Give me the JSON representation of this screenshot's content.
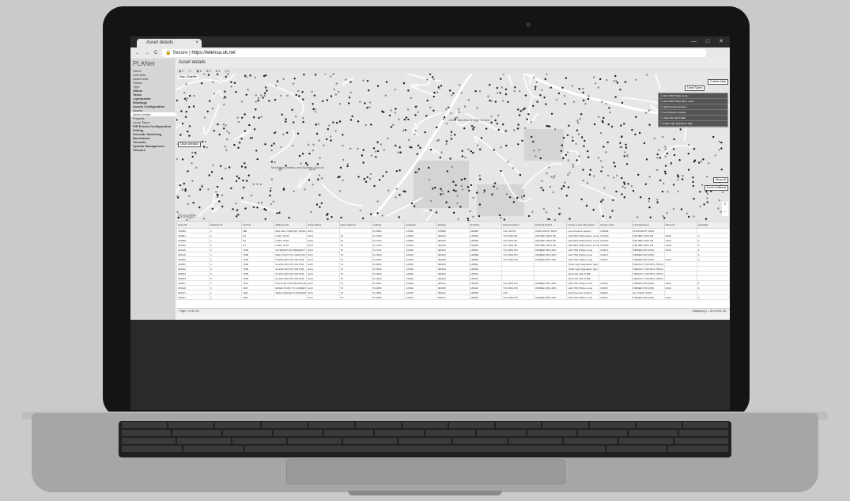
{
  "browser": {
    "tab_title": "Asset details",
    "tab_close": "×",
    "nav_back": "←",
    "nav_forward": "→",
    "nav_reload": "C",
    "url_secure": "Secure",
    "url_host": "https://telensa.uk.net"
  },
  "app": {
    "logo": "PLANet",
    "page_title": "Asset details",
    "sidebar": [
      {
        "label": "Home",
        "style": "plain"
      },
      {
        "label": "Licenses",
        "style": "plain"
      },
      {
        "label": "Asset Lists",
        "style": "plain"
      },
      {
        "label": "Places",
        "style": "plain"
      },
      {
        "label": "Type",
        "style": "plain"
      },
      {
        "label": "Status",
        "style": "bold"
      },
      {
        "label": "Tasks",
        "style": "bold"
      },
      {
        "label": "Lightmaster",
        "style": "bold"
      },
      {
        "label": "Readings",
        "style": "bold"
      },
      {
        "label": "Assets Configuration",
        "style": "bold"
      },
      {
        "label": "Assets",
        "style": "plain"
      },
      {
        "label": "Asset details",
        "style": "sel"
      },
      {
        "label": "Projects",
        "style": "plain"
      },
      {
        "label": "Lamp Types",
        "style": "plain"
      },
      {
        "label": "PIR Events Configuration",
        "style": "bold"
      },
      {
        "label": "Polling",
        "style": "bold"
      },
      {
        "label": "Override Switching",
        "style": "bold"
      },
      {
        "label": "Boundaries",
        "style": "bold"
      },
      {
        "label": "Telecells",
        "style": "bold"
      },
      {
        "label": "System Management",
        "style": "bold"
      },
      {
        "label": "Telecare",
        "style": "bold"
      }
    ],
    "map": {
      "tabs": [
        "Map",
        "Satellite"
      ],
      "clear_selection": "Clear selection",
      "custom_map": "Custom Map",
      "lamp_types": "Lamp Types",
      "show_all": "Show all",
      "zoom_to_filtered": "Zoom to filtered",
      "google": "Google",
      "zoom_in": "+",
      "zoom_out": "−",
      "place_1": "Anne Sandhurst High School",
      "place_2": "Monkland Infants and Nursery School"
    },
    "grid": {
      "columns": [
        "Asset ID",
        "Network ID",
        "Unit No",
        "Address Info",
        "Asset Status",
        "Asset Status 2",
        "Latitude",
        "Longitude",
        "Easting",
        "Northing",
        "Network Field 1",
        "Network Field 2",
        "Unique Lamp Information",
        "Design Lock",
        "Commissioned",
        "Street ID",
        "Capability"
      ],
      "rows": [
        [
          "766082",
          "1",
          "880",
          "MILL RD 1 HARTLEY ROAD",
          "ECO",
          "",
          "51.3683",
          "-0.8393",
          "478060",
          "169080",
          "TCU 4W PR",
          "PHPR MAXIT 100%",
          "Low Pressure Sodium",
          "010082",
          "PHPR MAXIT 100%",
          "",
          ""
        ],
        [
          "233921",
          "1",
          "P1",
          "LANG, P1ST",
          "ECO",
          "70",
          "51.3700",
          "-0.8310",
          "482121",
          "169530",
          "TCU 84W DP",
          "DIM 0BD 100% PR",
          "LED 84W Philips Micro Luma",
          "010340",
          "DIM 0BD 100% PR",
          "4/021",
          "9",
          "ON"
        ],
        [
          "233956",
          "1",
          "P4",
          "LANG, P1ST",
          "ECO",
          "70",
          "51.3714",
          "-0.8306",
          "482120",
          "169536",
          "TCU 84W DP",
          "DIM 0BD 100% PR",
          "LED 84W Philips Micro Luma",
          "010340",
          "DIM 0BD 100% PR",
          "4/021",
          "9",
          "ON"
        ],
        [
          "234023",
          "1",
          "P7",
          "LANG, P1ST",
          "ECO",
          "70",
          "51.3723",
          "-0.8304",
          "482118",
          "169540",
          "TCU 84W DP",
          "DIM 0BD 100% PR",
          "LED 84W Philips Micro Luma",
          "010340",
          "DIM 0BD 100% PR",
          "4/021",
          "9",
          "ON"
        ],
        [
          "234115",
          "1",
          "T503",
          "ALTERNATION CRESCENT",
          "ECO",
          "70",
          "51.3701",
          "-0.8322",
          "482104",
          "169552",
          "TCU 84W DIV",
          "DIMMED 050 100%",
          "LED 70W Philips Luma",
          "010017",
          "DIMMED 050 100%",
          "4/021",
          "9",
          "ON"
        ],
        [
          "235116",
          "1",
          "T508",
          "WELL FOOT TO LANGTON CL",
          "ECO",
          "70",
          "51.3693",
          "-0.8313",
          "482102",
          "169568",
          "TCU 84W DIV",
          "DIMMED 050 100%",
          "LED 70W Philips Luma",
          "010017",
          "DIMMED 050 100%",
          "",
          "9",
          "ON"
        ],
        [
          "235180",
          "1",
          "T509",
          "W HIGH RD NTS 200 PUB",
          "ECO",
          "70",
          "51.3663",
          "-0.8329",
          "482100",
          "169580",
          "TCU 84W DIV",
          "DIMMED 050 100%",
          "LED 70W Philips Luma",
          "010017",
          "DIMMED 050 100%",
          "4/021",
          "9",
          "ON"
        ],
        [
          "235181",
          "2",
          "T508",
          "W HIGH RD NTS 201 PUB",
          "ECO",
          "70",
          "51.3663",
          "-0.8329",
          "482100",
          "169590",
          "",
          "",
          "Traffic Light Regulation Sign",
          "",
          "DEFAULT CONTROL PROG.",
          "",
          "",
          ""
        ],
        [
          "235182",
          "3",
          "T508",
          "W HIGH RD NTS 202 PUB",
          "ECO",
          "70",
          "51.3663",
          "-0.8329",
          "482100",
          "169600",
          "",
          "",
          "Traffic Light Regulation Sign",
          "",
          "DEFAULT CONTROL PROG.",
          "",
          "",
          ""
        ],
        [
          "235183",
          "4",
          "T508",
          "W HIGH RD NTS 203 PUB",
          "ECO",
          "70",
          "51.3663",
          "-0.8329",
          "482100",
          "169610",
          "",
          "",
          "HIGH 4W LED TUBE",
          "",
          "DEFAULT CONTROL PROG.",
          "",
          "",
          ""
        ],
        [
          "235184",
          "5",
          "T508",
          "W HIGH RD NTS 204 PUB",
          "ECO",
          "70",
          "51.3663",
          "-0.8329",
          "482100",
          "169620",
          "",
          "",
          "HIGH 4W LED TUBE",
          "",
          "DEFAULT CONTROL PROG.",
          "",
          "",
          ""
        ],
        [
          "235221",
          "1",
          "T507",
          "OLD PUB, STN END ROUND",
          "ECO",
          "70",
          "51.3661",
          "-0.8326",
          "482101",
          "169630",
          "TCU 84W DIV",
          "DIMMED 050 100%",
          "LED 70W Philips Luma",
          "010017",
          "DIMMED 050 100%",
          "4/021",
          "9",
          "ON"
        ],
        [
          "235148",
          "1",
          "L507",
          "ESSEX ROAD TO CAMDEN HILL",
          "ECO",
          "70",
          "51.3653",
          "-0.8319",
          "482108",
          "169640",
          "TCU 84W DIV",
          "DIMMED 050 100%",
          "LED 70W Philips Luma",
          "010017",
          "DIMMED 050 100%",
          "4/021",
          "9",
          "ON"
        ],
        [
          "235217",
          "1",
          "L502",
          "SIDE GARAGE TO MORGAN LS",
          "ECO",
          "70",
          "51.3651",
          "-0.8315",
          "482112",
          "169650",
          "LPS",
          "",
          "High Pressure Sodium",
          "010017",
          "ALL NIGHT 100%",
          "",
          "",
          ""
        ],
        [
          "235221",
          "1",
          "L504",
          "",
          "ECO",
          "70",
          "51.3659",
          "-0.8322",
          "482114",
          "169660",
          "TCU 84W DIV",
          "DIMMED 050 100%",
          "LED 70W Philips Luma",
          "010017",
          "DIMMED 050 100%",
          "4/021",
          "9",
          "ON"
        ]
      ]
    },
    "pager": {
      "text": "Page 1 of 8,244",
      "right": "Displaying 1 - 25 of 206,101"
    }
  }
}
